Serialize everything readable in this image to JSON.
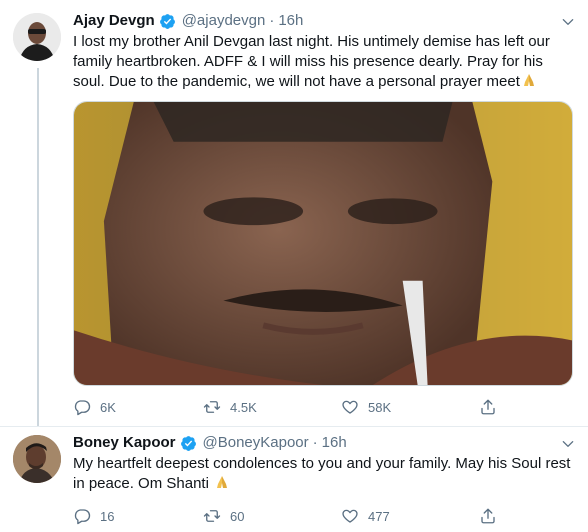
{
  "tweets": [
    {
      "name": "Ajay Devgn",
      "handle": "@ajaydevgn",
      "separator": "·",
      "time": "16h",
      "text": "I lost my brother Anil Devgan last night. His untimely demise has left our family heartbroken. ADFF & I will miss his presence dearly. Pray for his soul. Due to the pandemic, we will not have a personal prayer meet",
      "emoji": "folded-hands-icon",
      "replies": "6K",
      "retweets": "4.5K",
      "likes": "58K",
      "has_media": true
    },
    {
      "name": "Boney Kapoor",
      "handle": "@BoneyKapoor",
      "separator": "·",
      "time": "16h",
      "text": "My heartfelt deepest condolences to you and your family. May his Soul rest in peace. Om Shanti",
      "emoji": "folded-hands-icon",
      "replies": "16",
      "retweets": "60",
      "likes": "477",
      "has_media": false
    }
  ],
  "colors": {
    "verified": "#1da1f2",
    "secondary_text": "#5b7083",
    "thread_line": "#ccd6dd",
    "divider": "#e6ecf0"
  }
}
